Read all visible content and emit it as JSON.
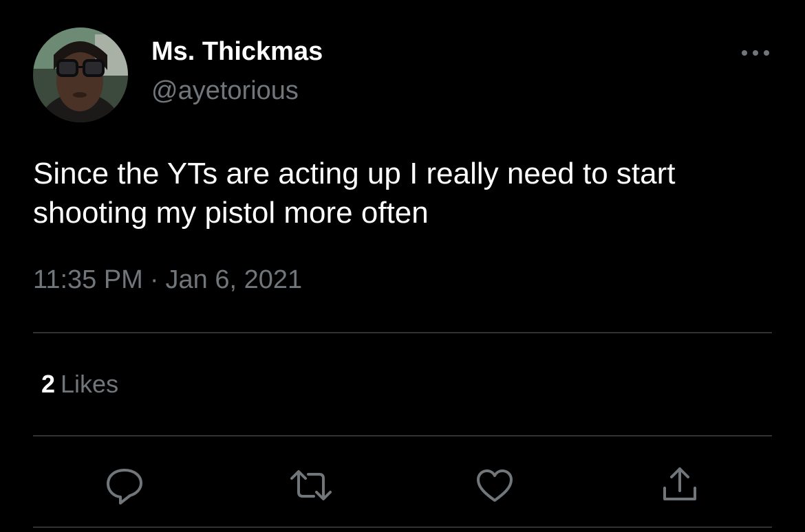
{
  "author": {
    "display_name": "Ms. Thickmas",
    "handle": "@ayetorious"
  },
  "tweet": {
    "text": "Since the YTs are acting up I really need to start shooting my pistol more often",
    "time": "11:35 PM",
    "separator": "·",
    "date": "Jan 6, 2021"
  },
  "engagement": {
    "likes_count": "2",
    "likes_label": "Likes"
  },
  "icons": {
    "more": "more-horizontal-icon",
    "reply": "reply-icon",
    "retweet": "retweet-icon",
    "like": "heart-icon",
    "share": "share-icon"
  },
  "colors": {
    "background": "#000000",
    "primary_text": "#ffffff",
    "secondary_text": "#71767b",
    "divider": "#2f3336"
  }
}
